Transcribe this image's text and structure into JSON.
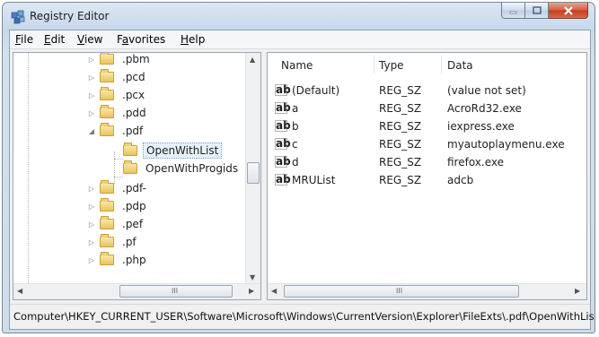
{
  "window": {
    "title": "Registry Editor",
    "icon": "registry-icon",
    "accent": "#c53b1b"
  },
  "menu": [
    {
      "first": "F",
      "rest": "ile"
    },
    {
      "first": "E",
      "rest": "dit"
    },
    {
      "first": "V",
      "rest": "iew"
    },
    {
      "pre": "F",
      "first": "a",
      "rest": "vorites"
    },
    {
      "first": "H",
      "rest": "elp"
    }
  ],
  "tree": {
    "items": [
      {
        "label": ".pbm",
        "expander": "▷"
      },
      {
        "label": ".pcd",
        "expander": "▷"
      },
      {
        "label": ".pcx",
        "expander": "▷"
      },
      {
        "label": ".pdd",
        "expander": "▷"
      },
      {
        "label": ".pdf",
        "expander": "◢"
      },
      {
        "label": "OpenWithList",
        "expander": ""
      },
      {
        "label": "OpenWithProgids",
        "expander": ""
      },
      {
        "label": ".pdf-",
        "expander": "▷"
      },
      {
        "label": ".pdp",
        "expander": "▷"
      },
      {
        "label": ".pef",
        "expander": "▷"
      },
      {
        "label": ".pf",
        "expander": "▷"
      },
      {
        "label": ".php",
        "expander": "▷"
      }
    ],
    "selected": "OpenWithList",
    "thumb_grip": "III"
  },
  "values": {
    "columns": [
      "Name",
      "Type",
      "Data"
    ],
    "rows": [
      {
        "name": "(Default)",
        "type": "REG_SZ",
        "data": "(value not set)"
      },
      {
        "name": "a",
        "type": "REG_SZ",
        "data": "AcroRd32.exe"
      },
      {
        "name": "b",
        "type": "REG_SZ",
        "data": "iexpress.exe"
      },
      {
        "name": "c",
        "type": "REG_SZ",
        "data": "myautoplaymenu.exe"
      },
      {
        "name": "d",
        "type": "REG_SZ",
        "data": "firefox.exe"
      },
      {
        "name": "MRUList",
        "type": "REG_SZ",
        "data": "adcb"
      }
    ],
    "icon_text": "ab",
    "thumb_grip": "III"
  },
  "status": {
    "path": "Computer\\HKEY_CURRENT_USER\\Software\\Microsoft\\Windows\\CurrentVersion\\Explorer\\FileExts\\.pdf\\OpenWithList"
  }
}
